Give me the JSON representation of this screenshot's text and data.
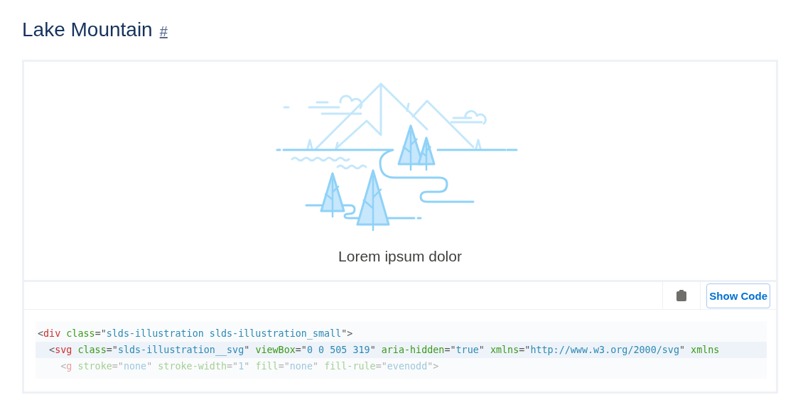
{
  "heading": {
    "title": "Lake Mountain",
    "anchor": "#"
  },
  "illustration": {
    "caption": "Lorem ipsum dolor"
  },
  "toolbar": {
    "button": "Show Code"
  },
  "code": {
    "lines": [
      {
        "highlighted": false,
        "faded": false,
        "tokens": [
          {
            "kind": "punct",
            "text": "<"
          },
          {
            "kind": "tag",
            "text": "div"
          },
          {
            "kind": "attr",
            "text": " class"
          },
          {
            "kind": "punct",
            "text": "=\""
          },
          {
            "kind": "value",
            "text": "slds-illustration slds-illustration_small"
          },
          {
            "kind": "punct",
            "text": "\">"
          }
        ]
      },
      {
        "highlighted": true,
        "faded": false,
        "tokens": [
          {
            "kind": "punct",
            "text": "  <"
          },
          {
            "kind": "tag",
            "text": "svg"
          },
          {
            "kind": "attr",
            "text": " class"
          },
          {
            "kind": "punct",
            "text": "=\""
          },
          {
            "kind": "value",
            "text": "slds-illustration__svg"
          },
          {
            "kind": "punct",
            "text": "\" "
          },
          {
            "kind": "attr",
            "text": "viewBox"
          },
          {
            "kind": "punct",
            "text": "=\""
          },
          {
            "kind": "value",
            "text": "0 0 505 319"
          },
          {
            "kind": "punct",
            "text": "\" "
          },
          {
            "kind": "attr",
            "text": "aria-hidden"
          },
          {
            "kind": "punct",
            "text": "=\""
          },
          {
            "kind": "value",
            "text": "true"
          },
          {
            "kind": "punct",
            "text": "\" "
          },
          {
            "kind": "attr",
            "text": "xmlns"
          },
          {
            "kind": "punct",
            "text": "=\""
          },
          {
            "kind": "value",
            "text": "http://www.w3.org/2000/svg"
          },
          {
            "kind": "punct",
            "text": "\" "
          },
          {
            "kind": "attr",
            "text": "xmlns"
          }
        ]
      },
      {
        "highlighted": false,
        "faded": true,
        "tokens": [
          {
            "kind": "punct",
            "text": "    <"
          },
          {
            "kind": "tag",
            "text": "g"
          },
          {
            "kind": "attr",
            "text": " stroke"
          },
          {
            "kind": "punct",
            "text": "=\""
          },
          {
            "kind": "value",
            "text": "none"
          },
          {
            "kind": "punct",
            "text": "\" "
          },
          {
            "kind": "attr",
            "text": "stroke-width"
          },
          {
            "kind": "punct",
            "text": "=\""
          },
          {
            "kind": "value",
            "text": "1"
          },
          {
            "kind": "punct",
            "text": "\" "
          },
          {
            "kind": "attr",
            "text": "fill"
          },
          {
            "kind": "punct",
            "text": "=\""
          },
          {
            "kind": "value",
            "text": "none"
          },
          {
            "kind": "punct",
            "text": "\" "
          },
          {
            "kind": "attr",
            "text": "fill-rule"
          },
          {
            "kind": "punct",
            "text": "=\""
          },
          {
            "kind": "value",
            "text": "evenodd"
          },
          {
            "kind": "punct",
            "text": "\">"
          }
        ]
      }
    ]
  }
}
